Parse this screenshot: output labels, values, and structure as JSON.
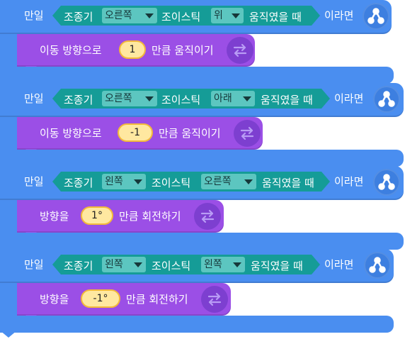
{
  "blocks": [
    {
      "if_label": "만일",
      "cond_subject": "조종기",
      "cond_dd1": "오른쪽",
      "cond_mid": "조이스틱",
      "cond_dd2": "위",
      "cond_end": "움직였을 때",
      "then_label": "이라면",
      "action_prefix": "이동 방향으로",
      "action_value": "1",
      "action_suffix": "만큼 움직이기"
    },
    {
      "if_label": "만일",
      "cond_subject": "조종기",
      "cond_dd1": "오른쪽",
      "cond_mid": "조이스틱",
      "cond_dd2": "아래",
      "cond_end": "움직였을 때",
      "then_label": "이라면",
      "action_prefix": "이동 방향으로",
      "action_value": "-1",
      "action_suffix": "만큼 움직이기"
    },
    {
      "if_label": "만일",
      "cond_subject": "조종기",
      "cond_dd1": "왼쪽",
      "cond_mid": "조이스틱",
      "cond_dd2": "오른쪽",
      "cond_end": "움직였을 때",
      "then_label": "이라면",
      "action_prefix": "방향을",
      "action_value": "1°",
      "action_suffix": "만큼 회전하기"
    },
    {
      "if_label": "만일",
      "cond_subject": "조종기",
      "cond_dd1": "왼쪽",
      "cond_mid": "조이스틱",
      "cond_dd2": "왼쪽",
      "cond_end": "움직였을 때",
      "then_label": "이라면",
      "action_prefix": "방향을",
      "action_value": "-1°",
      "action_suffix": "만큼 회전하기"
    }
  ],
  "icons": {
    "if_icon": "branch-icon",
    "action_icon": "swap-arrows-icon"
  },
  "colors": {
    "control_block": "#4a8ef0",
    "condition_block": "#159c97",
    "dropdown": "#5cc6c0",
    "motion_block": "#9b4fe6",
    "number_pill": "#ffe8a0"
  }
}
